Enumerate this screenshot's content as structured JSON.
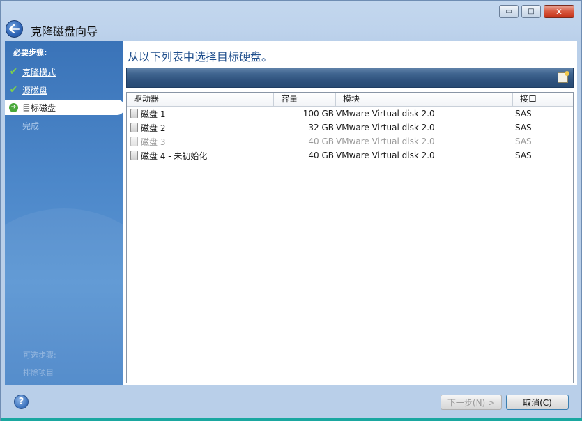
{
  "window": {
    "title": "克隆磁盘向导",
    "minimize_glyph": "▭",
    "maximize_glyph": "□",
    "close_glyph": "✕"
  },
  "sidebar": {
    "header": "必要步骤:",
    "steps": [
      {
        "label": "克隆模式",
        "state": "done"
      },
      {
        "label": "源磁盘",
        "state": "done"
      },
      {
        "label": "目标磁盘",
        "state": "current"
      },
      {
        "label": "完成",
        "state": "future"
      }
    ],
    "check_glyph": "✔",
    "arrow_glyph": "➔",
    "footer_1": "可选步骤:",
    "footer_2": "排除项目"
  },
  "main": {
    "instruction": "从以下列表中选择目标硬盘。",
    "columns": [
      "驱动器",
      "容量",
      "模块",
      "接口"
    ],
    "rows": [
      {
        "drive": "磁盘 1",
        "capacity": "100 GB",
        "model": "VMware Virtual disk 2.0",
        "interface": "SAS",
        "dim": false
      },
      {
        "drive": "磁盘 2",
        "capacity": "32 GB",
        "model": "VMware Virtual disk 2.0",
        "interface": "SAS",
        "dim": false
      },
      {
        "drive": "磁盘 3",
        "capacity": "40 GB",
        "model": "VMware Virtual disk 2.0",
        "interface": "SAS",
        "dim": true
      },
      {
        "drive": "磁盘 4 - 未初始化",
        "capacity": "40 GB",
        "model": "VMware Virtual disk 2.0",
        "interface": "SAS",
        "dim": false
      }
    ]
  },
  "footer": {
    "help_glyph": "?",
    "next_label": "下一步(N) >",
    "cancel_label": "取消(C)"
  },
  "colors": {
    "sidebar_blue": "#4c87c9",
    "instruction_blue": "#1f4e8c",
    "check_green": "#7fd14a"
  }
}
